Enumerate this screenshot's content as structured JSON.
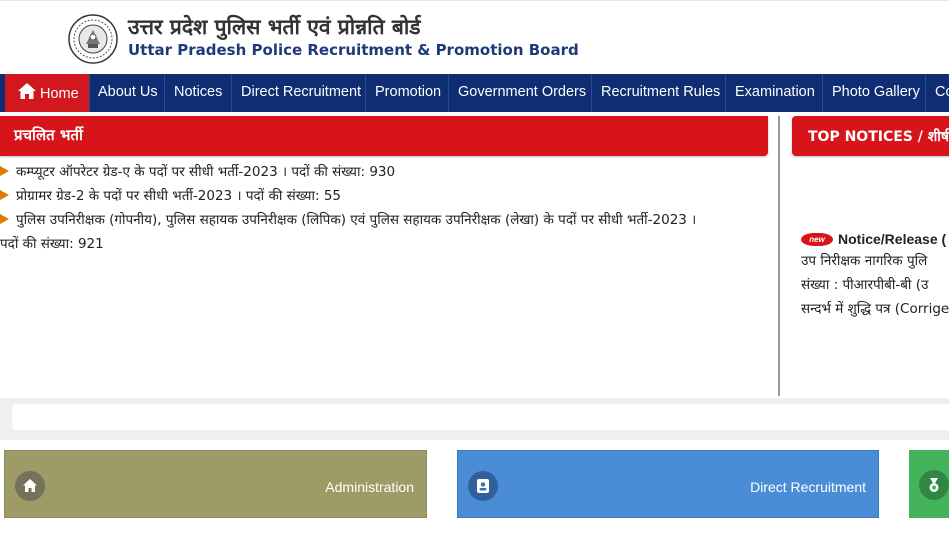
{
  "header": {
    "title_hi": "उत्तर प्रदेश पुलिस भर्ती एवं प्रोन्नति बोर्ड",
    "title_en": "Uttar Pradesh Police Recruitment & Promotion Board"
  },
  "nav": {
    "items": [
      "Home",
      "About Us",
      "Notices",
      "Direct Recruitment",
      "Promotion",
      "Government Orders",
      "Recruitment Rules",
      "Examination",
      "Photo Gallery",
      "Co"
    ]
  },
  "recruitment": {
    "heading": "प्रचलित भर्ती",
    "items": [
      "कम्प्यूटर ऑपरेटर ग्रेड-ए के पदों पर सीधी भर्ती-2023 । पदों की संख्या: 930",
      "प्रोग्रामर ग्रेड-2 के पदों पर सीधी भर्ती-2023 । पदों की संख्या: 55",
      "पुलिस उपनिरीक्षक (गोपनीय), पुलिस सहायक उपनिरीक्षक (लिपिक) एवं पुलिस सहायक उपनिरीक्षक (लेखा) के पदों पर सीधी भर्ती-2023 ।"
    ],
    "item3_cont": "पदों की संख्या: 921"
  },
  "top_notices": {
    "heading": "TOP NOTICES / शीर्ष स",
    "badge": "new",
    "notice_title": "Notice/Release (",
    "lines": [
      "उप निरीक्षक नागरिक पुलि",
      "संख्या : पीआरपीबी-बी (उ",
      "सन्दर्भ में शुद्धि पत्र (Corrige"
    ]
  },
  "cards": {
    "administration": "Administration",
    "direct_recruitment": "Direct Recruitment"
  },
  "colors": {
    "nav_bg": "#0f2d72",
    "accent_red": "#d7141a",
    "admin_card": "#9d9b66",
    "direct_card": "#4a8dd6",
    "third_card": "#43b35a"
  }
}
